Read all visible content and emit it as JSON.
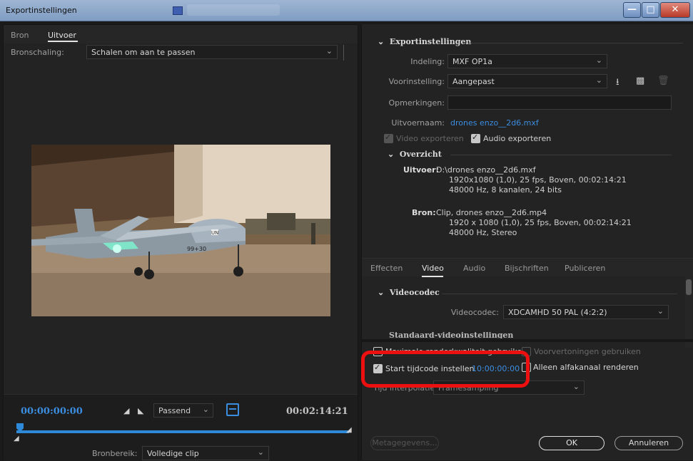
{
  "window": {
    "title": "Exportinstellingen"
  },
  "left": {
    "tabs": [
      "Bron",
      "Uitvoer"
    ],
    "scaling_label": "Bronschaling:",
    "scaling_value": "Schalen om aan te passen",
    "timecode_start": "00:00:00:00",
    "timecode_end": "00:02:14:21",
    "zoom_value": "Passend",
    "range_label": "Bronbereik:",
    "range_value": "Volledige clip",
    "preview": {
      "plane_marking_a": "UN",
      "plane_marking_b": "99+30"
    }
  },
  "right": {
    "export_heading": "Exportinstellingen",
    "format_label": "Indeling:",
    "format_value": "MXF OP1a",
    "preset_label": "Voorinstelling:",
    "preset_value": "Aangepast",
    "comments_label": "Opmerkingen:",
    "output_name_label": "Uitvoernaam:",
    "output_name_value": "drones enzo__2d6.mxf",
    "export_video_label": "Video exporteren",
    "export_audio_label": "Audio exporteren",
    "summary_heading": "Overzicht",
    "output_label": "Uitvoer:",
    "output_lines": [
      "D:\\drones enzo__2d6.mxf",
      "1920x1080 (1,0), 25 fps, Boven, 00:02:14:21",
      "48000 Hz, 8 kanalen, 24 bits"
    ],
    "source_label": "Bron:",
    "source_lines": [
      "Clip, drones enzo__2d6.mp4",
      "1920 x 1080 (1,0), 25 fps, Boven, 00:02:14:21",
      "48000 Hz, Stereo"
    ],
    "tabs": [
      "Effecten",
      "Video",
      "Audio",
      "Bijschriften",
      "Publiceren"
    ],
    "videocodec_heading": "Videocodec",
    "videocodec_label": "Videocodec:",
    "videocodec_value": "XDCAMHD 50 PAL (4:2:2)",
    "partial_heading": "Standaard-videoinstellingen",
    "max_render_label": "Maximale renderkwaliteit gebruiken",
    "previews_label": "Voorvertoningen gebruiken",
    "start_tc_label": "Start tijdcode instellen",
    "start_tc_value": "10:00:00:00",
    "alpha_label": "Alleen alfakanaal renderen",
    "interp_label": "Tijd interpolatie:",
    "interp_value": "Framesampling",
    "metadata_button": "Metagegevens...",
    "ok_button": "OK",
    "cancel_button": "Annuleren"
  },
  "colors": {
    "accent": "#3b8de0",
    "highlight": "#ec1010",
    "panel": "#232323"
  }
}
